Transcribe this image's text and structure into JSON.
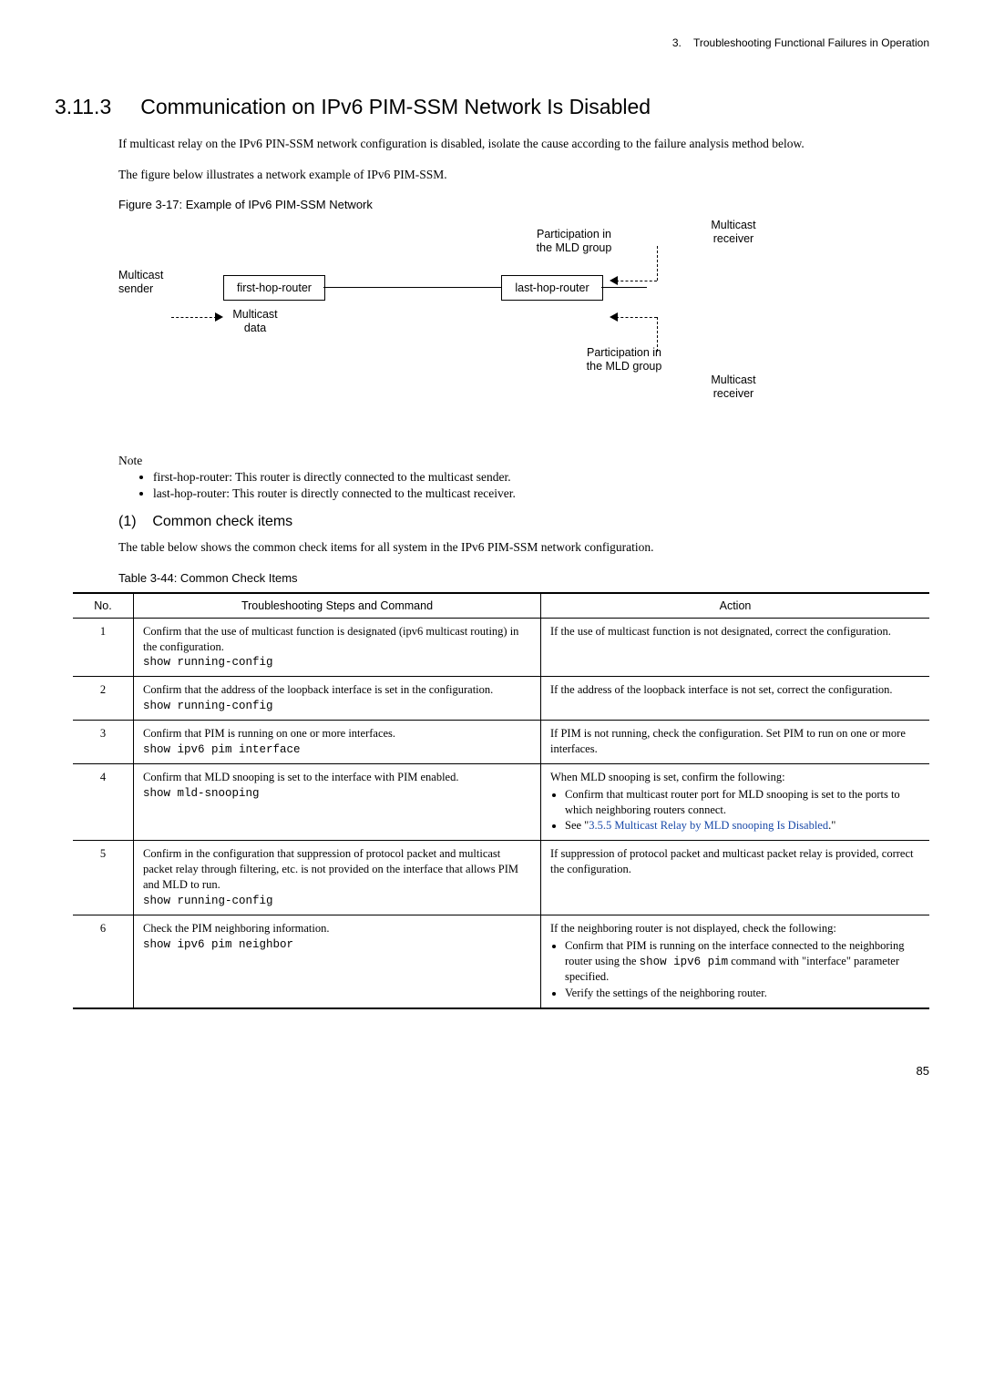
{
  "header": {
    "chapter": "3.",
    "chapter_title": "Troubleshooting Functional Failures in Operation"
  },
  "section": {
    "number": "3.11.3",
    "title": "Communication on IPv6 PIM-SSM Network Is Disabled",
    "para1": "If multicast relay on the IPv6 PIN-SSM network configuration is disabled, isolate the cause according to the failure analysis method below.",
    "para2": "The figure below illustrates a network example of IPv6 PIM-SSM."
  },
  "figure": {
    "caption": "Figure 3-17: Example of IPv6 PIM-SSM Network",
    "labels": {
      "multicast_sender": "Multicast\nsender",
      "first_hop": "first-hop-router",
      "last_hop": "last-hop-router",
      "multicast_data": "Multicast\ndata",
      "participation1": "Participation in\nthe MLD group",
      "participation2": "Participation in\nthe MLD group",
      "multicast_receiver1": "Multicast\nreceiver",
      "multicast_receiver2": "Multicast\nreceiver"
    }
  },
  "note": {
    "head": "Note",
    "items": [
      "first-hop-router: This router is directly connected to the multicast sender.",
      "last-hop-router: This router is directly connected to the multicast receiver."
    ]
  },
  "subsection": {
    "number": "(1)",
    "title": "Common check items",
    "para": "The table below shows the common check items for all system in the IPv6 PIM-SSM network configuration."
  },
  "table": {
    "caption": "Table 3-44: Common Check Items",
    "headers": {
      "no": "No.",
      "steps": "Troubleshooting Steps and Command",
      "action": "Action"
    },
    "rows": [
      {
        "no": "1",
        "steps_text": "Confirm that the use of multicast function is designated (ipv6 multicast routing) in the configuration.",
        "steps_cmd": "show running-config",
        "action_text": "If the use of multicast function is not designated, correct the configuration."
      },
      {
        "no": "2",
        "steps_text": "Confirm that the address of the loopback interface is set in the configuration.",
        "steps_cmd": "show running-config",
        "action_text": "If the address of the loopback interface is not set, correct the configuration."
      },
      {
        "no": "3",
        "steps_text": "Confirm that PIM is running on one or more interfaces.",
        "steps_cmd": "show ipv6 pim interface",
        "action_text": "If PIM is not running, check the configuration. Set PIM to run on one or more interfaces."
      },
      {
        "no": "4",
        "steps_text": "Confirm that MLD snooping is set to the interface with PIM enabled.",
        "steps_cmd": "show mld-snooping",
        "action_intro": "When MLD snooping is set, confirm the following:",
        "action_bullets": [
          "Confirm that multicast router port for MLD snooping is set to the ports to which neighboring routers connect.",
          "See \"3.5.5 Multicast Relay by MLD snooping Is Disabled.\""
        ],
        "action_link_index": 1,
        "action_link_text": "3.5.5 Multicast Relay by MLD snooping Is Disabled"
      },
      {
        "no": "5",
        "steps_text": "Confirm in the configuration that suppression of protocol packet and multicast packet relay through filtering, etc. is not provided on the interface that allows PIM and MLD to run.",
        "steps_cmd": "show running-config",
        "action_text": "If suppression of protocol packet and multicast packet relay is provided, correct the configuration."
      },
      {
        "no": "6",
        "steps_text": "Check the PIM neighboring information.",
        "steps_cmd": "show ipv6 pim neighbor",
        "action_intro": "If the neighboring router is not displayed, check the following:",
        "action_bullets_6": {
          "b1_pre": "Confirm that PIM is running on the interface connected to the neighboring router using the ",
          "b1_code": "show ipv6 pim",
          "b1_post": " command with \"interface\" parameter specified.",
          "b2": "Verify the settings of the neighboring router."
        }
      }
    ]
  },
  "page_num": "85"
}
